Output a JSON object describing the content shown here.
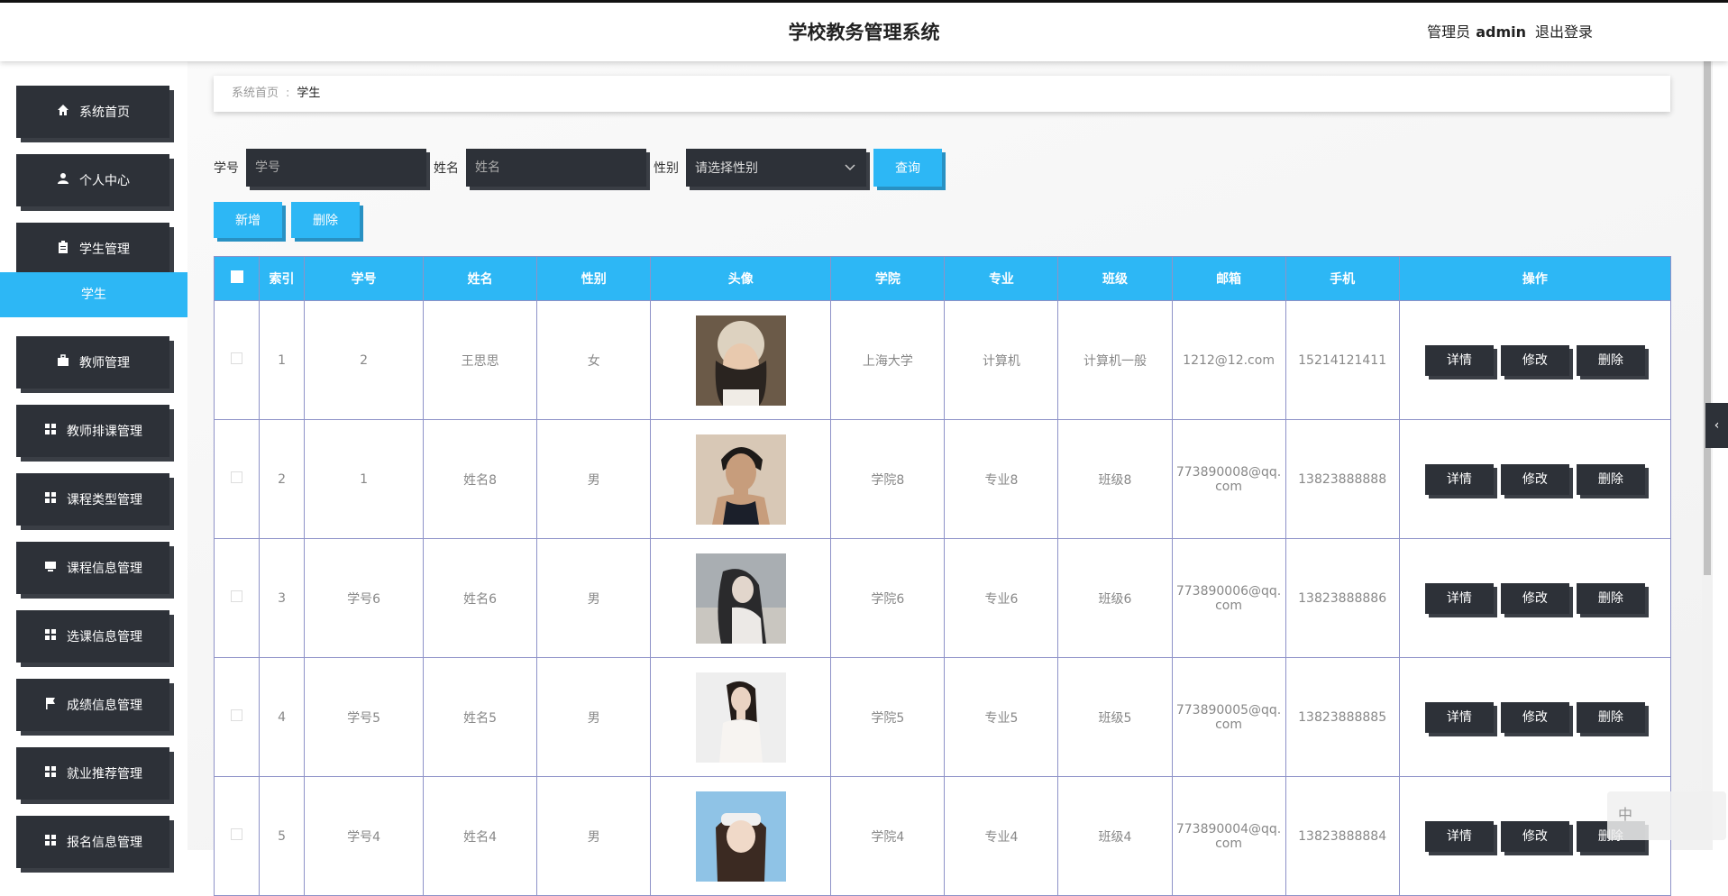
{
  "header": {
    "title": "学校教务管理系统",
    "user_role": "管理员",
    "user_name": "admin",
    "logout": "退出登录"
  },
  "sidebar": {
    "items": [
      {
        "label": "系统首页",
        "icon": "home-icon"
      },
      {
        "label": "个人中心",
        "icon": "user-icon"
      },
      {
        "label": "学生管理",
        "icon": "clipboard-icon"
      },
      {
        "label": "教师管理",
        "icon": "briefcase-icon"
      },
      {
        "label": "教师排课管理",
        "icon": "grid-icon"
      },
      {
        "label": "课程类型管理",
        "icon": "grid-icon"
      },
      {
        "label": "课程信息管理",
        "icon": "monitor-icon"
      },
      {
        "label": "选课信息管理",
        "icon": "grid-icon"
      },
      {
        "label": "成绩信息管理",
        "icon": "flag-icon"
      },
      {
        "label": "就业推荐管理",
        "icon": "grid-icon"
      },
      {
        "label": "报名信息管理",
        "icon": "grid-icon"
      }
    ],
    "sub_item": "学生"
  },
  "breadcrumb": {
    "home": "系统首页",
    "current": "学生"
  },
  "search": {
    "xuehao_label": "学号",
    "xuehao_placeholder": "学号",
    "xingming_label": "姓名",
    "xingming_placeholder": "姓名",
    "xingbie_label": "性别",
    "xingbie_placeholder": "请选择性别",
    "query_button": "查询"
  },
  "actions": {
    "add": "新增",
    "delete": "删除"
  },
  "table": {
    "headers": [
      "索引",
      "学号",
      "姓名",
      "性别",
      "头像",
      "学院",
      "专业",
      "班级",
      "邮箱",
      "手机",
      "操作"
    ],
    "op_labels": {
      "detail": "详情",
      "edit": "修改",
      "delete": "删除"
    },
    "rows": [
      {
        "index": "1",
        "xuehao": "2",
        "xingming": "王思思",
        "xingbie": "女",
        "xueyuan": "上海大学",
        "zhuanye": "计算机",
        "banji": "计算机一般",
        "email": "1212@12.com",
        "phone": "15214121411"
      },
      {
        "index": "2",
        "xuehao": "1",
        "xingming": "姓名8",
        "xingbie": "男",
        "xueyuan": "学院8",
        "zhuanye": "专业8",
        "banji": "班级8",
        "email": "773890008@qq.com",
        "phone": "13823888888"
      },
      {
        "index": "3",
        "xuehao": "学号6",
        "xingming": "姓名6",
        "xingbie": "男",
        "xueyuan": "学院6",
        "zhuanye": "专业6",
        "banji": "班级6",
        "email": "773890006@qq.com",
        "phone": "13823888886"
      },
      {
        "index": "4",
        "xuehao": "学号5",
        "xingming": "姓名5",
        "xingbie": "男",
        "xueyuan": "学院5",
        "zhuanye": "专业5",
        "banji": "班级5",
        "email": "773890005@qq.com",
        "phone": "13823888885"
      },
      {
        "index": "5",
        "xuehao": "学号4",
        "xingming": "姓名4",
        "xingbie": "男",
        "xueyuan": "学院4",
        "zhuanye": "专业4",
        "banji": "班级4",
        "email": "773890004@qq.com",
        "phone": "13823888884"
      }
    ]
  },
  "ime": {
    "label": "中"
  },
  "colors": {
    "accent": "#2db7f5",
    "dark": "#2d3138",
    "border": "#8e92c8"
  }
}
